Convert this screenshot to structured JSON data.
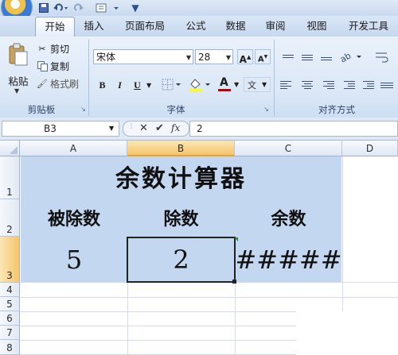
{
  "quick_access": {
    "save_icon": "save-icon",
    "undo_icon": "undo-icon",
    "redo_icon": "redo-icon",
    "customize": "▼"
  },
  "tabs": [
    "开始",
    "插入",
    "页面布局",
    "公式",
    "数据",
    "审阅",
    "视图",
    "开发工具"
  ],
  "active_tab": "开始",
  "clipboard": {
    "paste": "粘贴",
    "cut": "剪切",
    "copy": "复制",
    "format_painter": "格式刷",
    "group_label": "剪贴板"
  },
  "font": {
    "name": "宋体",
    "size": "28",
    "grow": "A",
    "shrink": "A",
    "bold": "B",
    "italic": "I",
    "underline": "U",
    "font_color_letter": "A",
    "phonetic": "文",
    "group_label": "字体",
    "font_color": "#c00000",
    "fill_color": "#ffff00"
  },
  "alignment": {
    "group_label": "对齐方式"
  },
  "formula_bar": {
    "name_box": "B3",
    "cancel": "✕",
    "enter": "✔",
    "fx": "fx",
    "value": "2"
  },
  "columns": [
    "A",
    "B",
    "C",
    "D"
  ],
  "selected_column": "B",
  "rows": [
    "1",
    "2",
    "3",
    "4",
    "5",
    "6",
    "7",
    "8"
  ],
  "selected_row": "3",
  "cells": {
    "title": "余数计算器",
    "header_a": "被除数",
    "header_b": "除数",
    "header_c": "余数",
    "value_a": "5",
    "value_b": "2",
    "value_c": "#####"
  },
  "colors": {
    "table_fill": "#c3d8f0",
    "selection": "#f5c56a",
    "ribbon": "#dbe7f6"
  }
}
